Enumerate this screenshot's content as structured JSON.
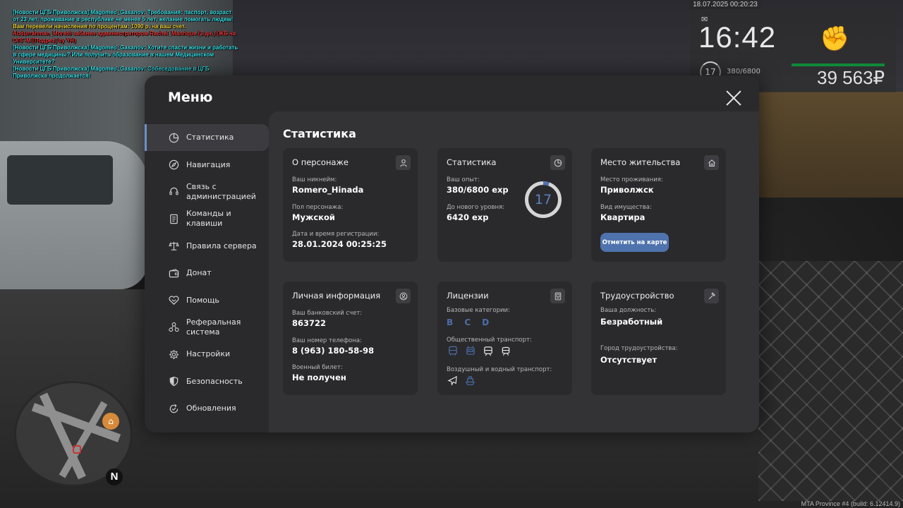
{
  "chat": [
    {
      "text": "[Новости ЦГБ Приволжска] Magomed_Gasanov: Требования: паспорт, возраст от 23 лет, проживание в республике не менее 5 лет, желание помогать людям!",
      "color": "#39e0e8"
    },
    {
      "text": "Вам перевели начисления по процентам: 1090 р. на ваш счет.",
      "color": "#e8d23a"
    },
    {
      "text": "Abdurrahman_Moretti забанен администратором Rachel_Manrique (3 дн.) (ЖБ на ОПГ-М [Подрез] by YH)",
      "color": "#e83a3a"
    },
    {
      "text": "[Новости ЦГБ Приволжска] Magomed_Gasanov: Хотите спасти жизни и работать в сфере медицины? Или получить образование в нашем Медицинском Университете?",
      "color": "#39e0e8"
    },
    {
      "text": "[Новости ЦГБ Приволжска] Magomed_Gasanov: Собеседование в ЦГБ Приволжска продолжается!",
      "color": "#39e0e8"
    }
  ],
  "hud": {
    "datetime": "18.07.2025 00:20:23",
    "time": "16:42",
    "level": "17",
    "exp": "380/6800",
    "money": "39 563₽"
  },
  "build": "MTA Province #4 (build: 6.12414.9)",
  "minimap": {
    "north": "N"
  },
  "menu": {
    "title": "Меню",
    "nav": [
      {
        "label": "Статистика",
        "icon": "pie-chart-icon",
        "active": true
      },
      {
        "label": "Навигация",
        "icon": "compass-icon"
      },
      {
        "label": "Связь с администрацией",
        "icon": "headset-icon"
      },
      {
        "label": "Команды и клавиши",
        "icon": "document-icon"
      },
      {
        "label": "Правила сервера",
        "icon": "scales-icon"
      },
      {
        "label": "Донат",
        "icon": "wallet-icon"
      },
      {
        "label": "Помощь",
        "icon": "handshake-icon"
      },
      {
        "label": "Реферальная система",
        "icon": "referral-icon"
      },
      {
        "label": "Настройки",
        "icon": "gear-icon"
      },
      {
        "label": "Безопасность",
        "icon": "shield-icon"
      },
      {
        "label": "Обновления",
        "icon": "update-icon"
      }
    ],
    "content_title": "Статистика",
    "character": {
      "title": "О персонаже",
      "nick_label": "Ваш никнейм:",
      "nick": "Romero_Hinada",
      "gender_label": "Пол персонажа:",
      "gender": "Мужской",
      "reg_label": "Дата и время регистрации:",
      "reg": "28.01.2024 00:25:25"
    },
    "stats": {
      "title": "Статистика",
      "exp_label": "Ваш опыт:",
      "exp": "380/6800 exp",
      "next_label": "До нового уровня:",
      "next": "6420 exp",
      "level": "17",
      "progress": 0.0559
    },
    "residence": {
      "title": "Место жительства",
      "place_label": "Место проживания:",
      "place": "Приволжск",
      "property_label": "Вид имущества:",
      "property": "Квартира",
      "button": "Отметить на карте"
    },
    "personal": {
      "title": "Личная информация",
      "bank_label": "Ваш банковский счет:",
      "bank": "863722",
      "phone_label": "Ваш номер телефона:",
      "phone": "8 (963) 180-58-98",
      "military_label": "Военный билет:",
      "military": "Не получен"
    },
    "licenses": {
      "title": "Лицензии",
      "base_label": "Базовые категории:",
      "base": "B C D",
      "public_label": "Общественный транспорт:",
      "air_label": "Воздушный и водный транспорт:"
    },
    "employment": {
      "title": "Трудоустройство",
      "position_label": "Ваша должность:",
      "position": "Безработный",
      "city_label": "Город трудоустройства:",
      "city": "Отсутствует"
    }
  },
  "colors": {
    "accent": "#4f73ad",
    "active_border": "#6d8fc9",
    "license_active": "#4b6ea9"
  }
}
